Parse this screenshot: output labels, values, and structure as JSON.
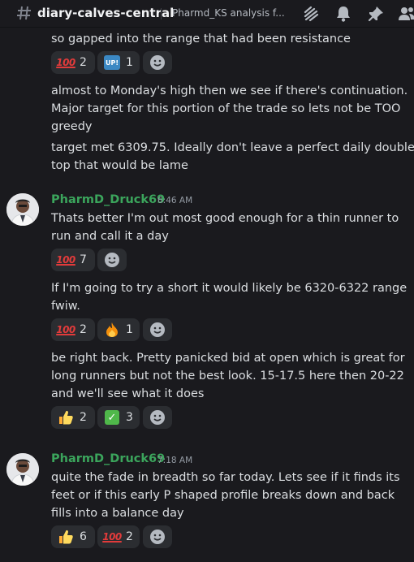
{
  "header": {
    "channel": "diary-calves-central",
    "topic": "Pharmd_KS analysis f..."
  },
  "messages": [
    {
      "lines": [
        "so gapped into the range that had been resistance"
      ]
    },
    {
      "reactions": [
        {
          "emoji": "100",
          "count": "2"
        },
        {
          "emoji": "up",
          "count": "1"
        }
      ]
    },
    {
      "lines": [
        "almost to Monday's high then we see if there's continuation.",
        "Major target for this portion of the trade so lets not be TOO",
        "greedy"
      ]
    },
    {
      "lines": [
        "target met 6309.75. Ideally don't leave a perfect daily double",
        "top that would be lame"
      ]
    }
  ],
  "posts": [
    {
      "author": "PharmD_Druck69",
      "time": "6:46 AM",
      "blocks": [
        {
          "lines": [
            "Thats better I'm out most good enough for a thin runner to",
            "run and call it a day"
          ],
          "reactions": [
            {
              "emoji": "100",
              "count": "7"
            }
          ]
        },
        {
          "lines": [
            "If I'm going to try a short it would likely be 6320-6322 range",
            "fwiw."
          ],
          "reactions": [
            {
              "emoji": "100",
              "count": "2"
            },
            {
              "emoji": "fire",
              "count": "1"
            }
          ]
        },
        {
          "lines": [
            "be right back. Pretty panicked bid at open which is great for",
            "long runners but not the best look. 15-17.5 here then 20-22",
            "and we'll see what it does"
          ],
          "reactions": [
            {
              "emoji": "thumbs-up",
              "count": "2"
            },
            {
              "emoji": "check",
              "count": "3"
            }
          ]
        }
      ]
    },
    {
      "author": "PharmD_Druck69",
      "time": "7:18 AM",
      "blocks": [
        {
          "lines": [
            "quite the fade in breadth so far today. Lets see if it finds its",
            "feet or if this early P shaped profile breaks down and back",
            "fills into a balance day"
          ],
          "reactions": [
            {
              "emoji": "thumbs-up",
              "count": "6"
            },
            {
              "emoji": "100",
              "count": "2"
            }
          ]
        }
      ]
    }
  ],
  "colors": {
    "background": "#1a1a1e",
    "username": "#3ba55c",
    "reaction_bg": "#2b2d31"
  }
}
